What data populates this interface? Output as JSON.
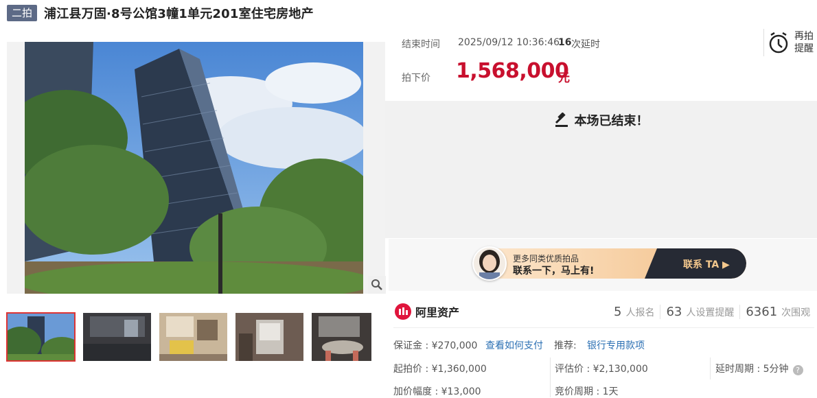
{
  "header": {
    "badge": "二拍",
    "title": "浦江县万固·8号公馆3幢1单元201室住宅房地产"
  },
  "auction": {
    "end_label": "结束时间",
    "end_time": "2025/09/12 10:36:46",
    "delay_count": "16",
    "delay_text": "次延时",
    "price_label": "拍下价",
    "price": "1,568,000",
    "price_unit": "元",
    "remind_label": "再拍提醒",
    "ended_text": "本场已结束！"
  },
  "promo": {
    "line1": "更多同类优质拍品",
    "line2": "联系一下，马上有!",
    "cta": "联系 TA"
  },
  "stats": {
    "brand": "阿里资产",
    "items": [
      {
        "num": "5",
        "label": "人报名"
      },
      {
        "num": "63",
        "label": "人设置提醒"
      },
      {
        "num": "6361",
        "label": "次围观"
      }
    ]
  },
  "details": {
    "deposit": "保证金 : ¥270,000",
    "deposit_link": "查看如何支付",
    "recommend_label": "推荐:",
    "recommend_link": "银行专用款项",
    "start_price": "起拍价 : ¥1,360,000",
    "appraisal": "评估价 : ¥2,130,000",
    "delay_period": "延时周期 : 5分钟",
    "increment": "加价幅度 : ¥13,000",
    "bid_period": "竞价周期 : 1天"
  },
  "colors": {
    "price": "#c8102e",
    "badge": "#5d6a86",
    "link": "#2a6fb3"
  }
}
